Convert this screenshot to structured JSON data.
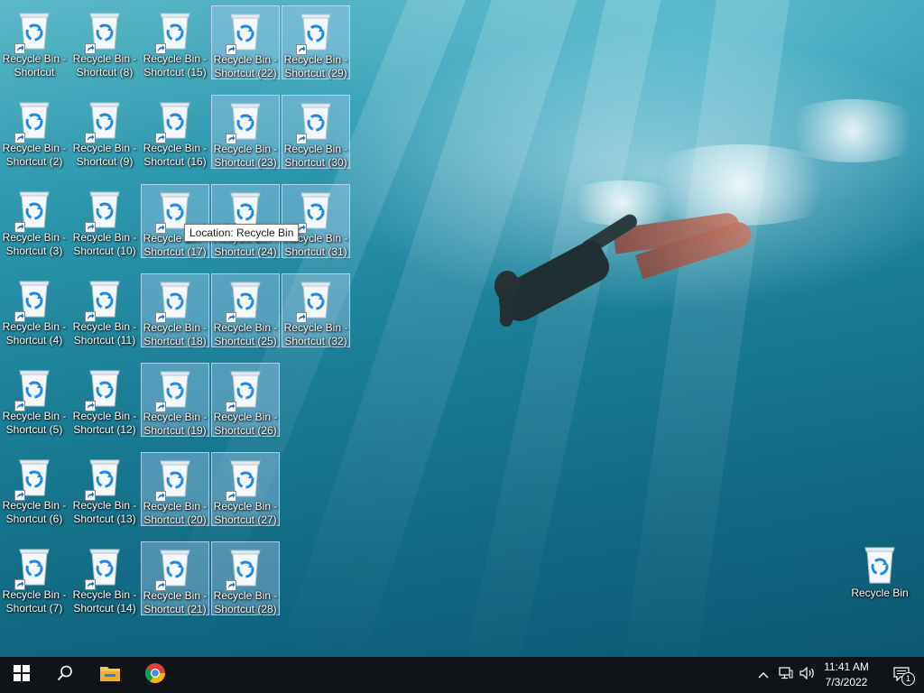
{
  "desktop": {
    "shortcuts": [
      {
        "line1": "Recycle Bin -",
        "line2": "Shortcut"
      },
      {
        "line1": "Recycle Bin -",
        "line2": "Shortcut (2)"
      },
      {
        "line1": "Recycle Bin -",
        "line2": "Shortcut (3)"
      },
      {
        "line1": "Recycle Bin -",
        "line2": "Shortcut (4)"
      },
      {
        "line1": "Recycle Bin -",
        "line2": "Shortcut (5)"
      },
      {
        "line1": "Recycle Bin -",
        "line2": "Shortcut (6)"
      },
      {
        "line1": "Recycle Bin -",
        "line2": "Shortcut (7)"
      },
      {
        "line1": "Recycle Bin -",
        "line2": "Shortcut (8)"
      },
      {
        "line1": "Recycle Bin -",
        "line2": "Shortcut (9)"
      },
      {
        "line1": "Recycle Bin -",
        "line2": "Shortcut (10)"
      },
      {
        "line1": "Recycle Bin -",
        "line2": "Shortcut (11)"
      },
      {
        "line1": "Recycle Bin -",
        "line2": "Shortcut (12)"
      },
      {
        "line1": "Recycle Bin -",
        "line2": "Shortcut (13)"
      },
      {
        "line1": "Recycle Bin -",
        "line2": "Shortcut (14)"
      },
      {
        "line1": "Recycle Bin -",
        "line2": "Shortcut (15)"
      },
      {
        "line1": "Recycle Bin -",
        "line2": "Shortcut (16)"
      },
      {
        "line1": "Recycle Bin -",
        "line2": "Shortcut (17)"
      },
      {
        "line1": "Recycle Bin -",
        "line2": "Shortcut (18)"
      },
      {
        "line1": "Recycle Bin -",
        "line2": "Shortcut (19)"
      },
      {
        "line1": "Recycle Bin -",
        "line2": "Shortcut (20)"
      },
      {
        "line1": "Recycle Bin -",
        "line2": "Shortcut (21)"
      },
      {
        "line1": "Recycle Bin -",
        "line2": "Shortcut (22)"
      },
      {
        "line1": "Recycle Bin -",
        "line2": "Shortcut (23)"
      },
      {
        "line1": "Recycle Bin -",
        "line2": "Shortcut (24)"
      },
      {
        "line1": "Recycle Bin -",
        "line2": "Shortcut (25)"
      },
      {
        "line1": "Recycle Bin -",
        "line2": "Shortcut (26)"
      },
      {
        "line1": "Recycle Bin -",
        "line2": "Shortcut (27)"
      },
      {
        "line1": "Recycle Bin -",
        "line2": "Shortcut (28)"
      },
      {
        "line1": "Recycle Bin -",
        "line2": "Shortcut (29)"
      },
      {
        "line1": "Recycle Bin -",
        "line2": "Shortcut (30)"
      },
      {
        "line1": "Recycle Bin -",
        "line2": "Shortcut (31)"
      },
      {
        "line1": "Recycle Bin -",
        "line2": "Shortcut (32)"
      }
    ],
    "recycle_bin": {
      "label": "Recycle Bin"
    },
    "tooltip": {
      "text": "Location: Recycle Bin"
    }
  },
  "taskbar": {
    "start_icon": "windows-logo-icon",
    "search_icon": "search-icon",
    "pinned": [
      {
        "name": "file-explorer",
        "icon": "folder-icon"
      },
      {
        "name": "google-chrome",
        "icon": "chrome-icon"
      }
    ],
    "tray": {
      "overflow_icon": "chevron-up-icon",
      "network_icon": "network-icon",
      "volume_icon": "speaker-icon"
    },
    "clock": {
      "time": "11:41 AM",
      "date": "7/3/2022"
    },
    "notifications": {
      "icon": "action-center-icon",
      "count": "1"
    }
  },
  "colors": {
    "taskbar_bg": "#101418",
    "selection_fill": "#aacdf0",
    "bin_blue": "#1e88e5"
  }
}
